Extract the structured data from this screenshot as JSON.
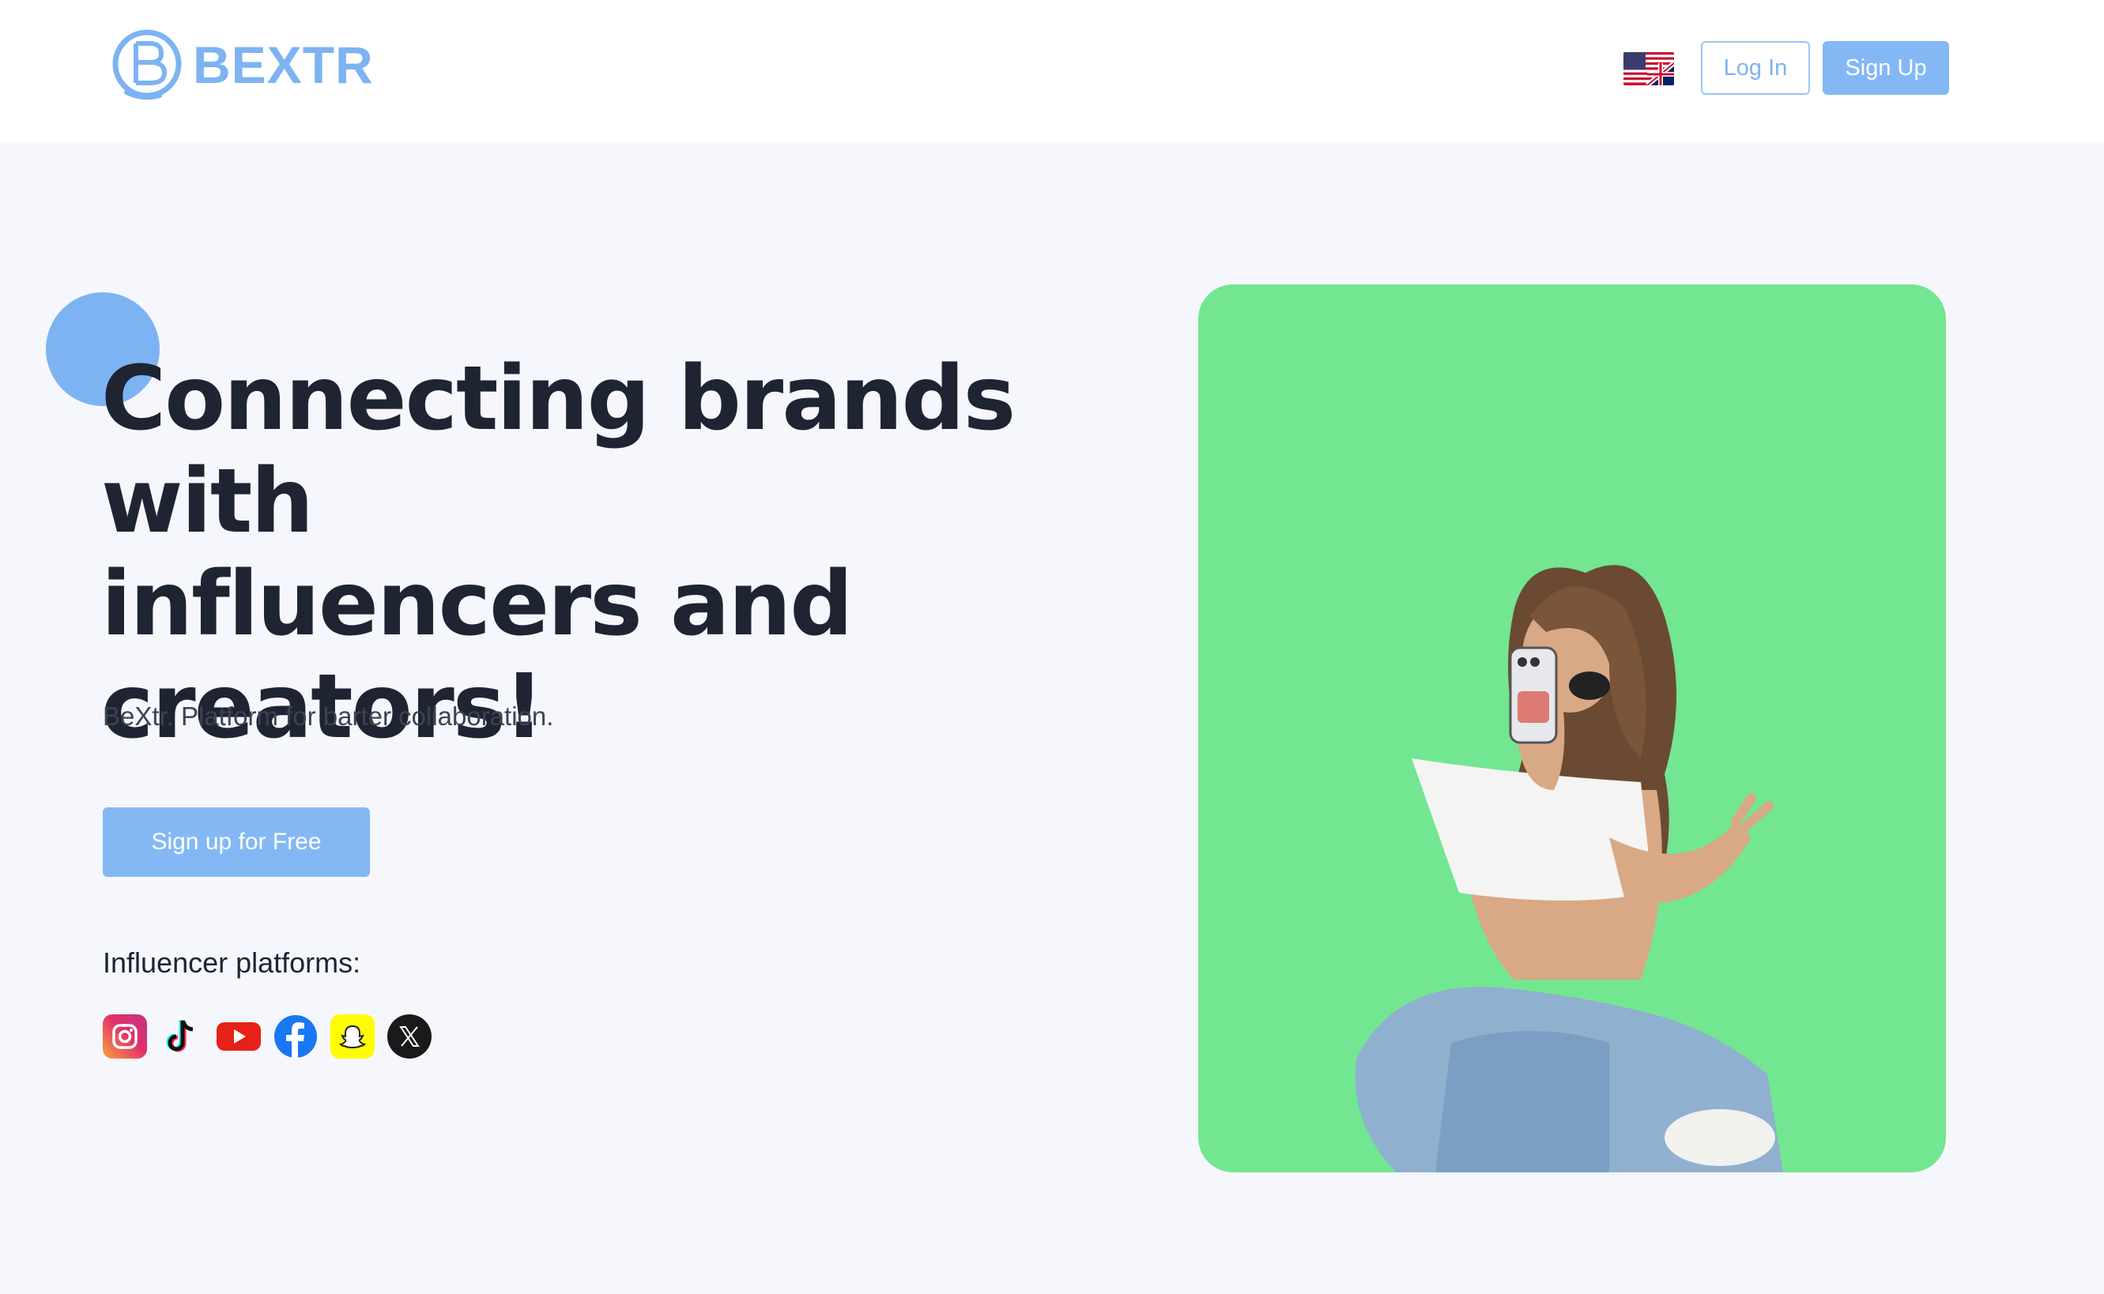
{
  "header": {
    "brand": "BEXTR",
    "language_icon": "uk-us-flag-icon",
    "login_label": "Log In",
    "signup_label": "Sign Up"
  },
  "hero": {
    "headline_lines": [
      "Connecting brands with",
      "influencers and",
      "creators!"
    ],
    "subtitle": "BeXtr. Platform for barter collaboration.",
    "cta_label": "Sign up for Free",
    "platforms_label": "Influencer platforms:",
    "platforms": [
      "instagram-icon",
      "tiktok-icon",
      "youtube-icon",
      "facebook-icon",
      "snapchat-icon",
      "x-icon"
    ],
    "image_subject": "influencer-photo"
  },
  "colors": {
    "brand_blue": "#7db3f3",
    "button_blue": "#84b8f5",
    "hero_green": "#73e691",
    "page_bg": "#f6f7fc",
    "text_dark": "#1f2433"
  }
}
